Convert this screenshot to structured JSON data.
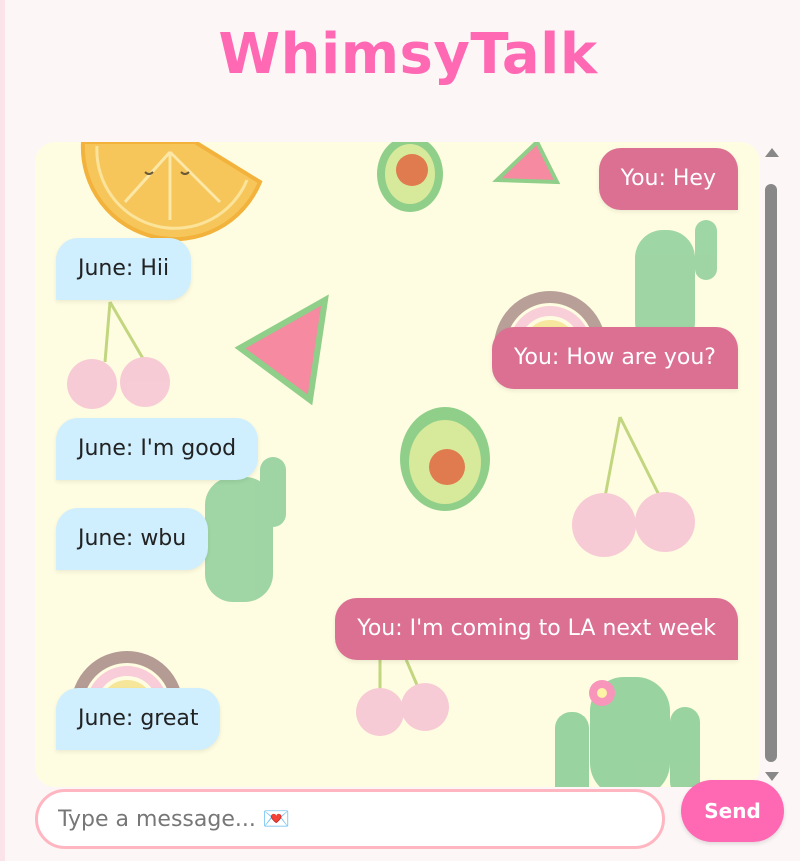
{
  "app": {
    "title": "WhimsyTalk"
  },
  "colors": {
    "title": "#ff69b4",
    "chat_background": "#fffde1",
    "outgoing_bubble": "#db7093",
    "incoming_bubble": "#cfeefe",
    "send_button": "#ff69b4",
    "input_border": "#ffb6c1"
  },
  "background_decorations": [
    "orange-slice",
    "avocado",
    "watermelon-slice",
    "cactus",
    "rainbow",
    "cherries"
  ],
  "messages": [
    {
      "side": "out",
      "text": "You: Hey"
    },
    {
      "side": "in",
      "text": "June: Hii"
    },
    {
      "side": "out",
      "text": "You: How are you?"
    },
    {
      "side": "in",
      "text": "June: I'm good"
    },
    {
      "side": "in",
      "text": "June: wbu"
    },
    {
      "side": "out",
      "text": "You: I'm coming to LA next week"
    },
    {
      "side": "in",
      "text": "June: great"
    }
  ],
  "composer": {
    "placeholder": "Type a message... 💌",
    "value": "",
    "send_label": "Send"
  }
}
